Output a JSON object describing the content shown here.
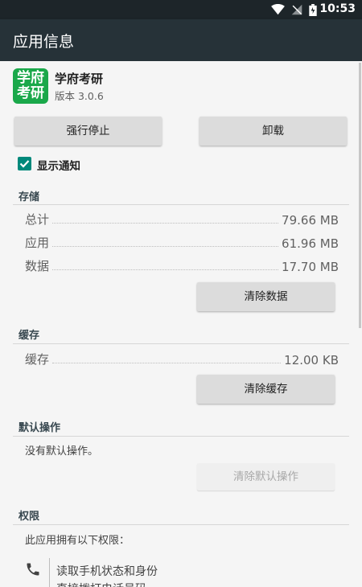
{
  "status": {
    "time": "10:53"
  },
  "appbar": {
    "title": "应用信息"
  },
  "app": {
    "icon_text_top": "学府",
    "icon_text_bottom": "考研",
    "name": "学府考研",
    "version": "版本 3.0.6"
  },
  "actions": {
    "force_stop": "强行停止",
    "uninstall": "卸载"
  },
  "notification": {
    "label": "显示通知",
    "checked": true
  },
  "storage": {
    "title": "存储",
    "rows": [
      {
        "label": "总计",
        "value": "79.66 MB"
      },
      {
        "label": "应用",
        "value": "61.96 MB"
      },
      {
        "label": "数据",
        "value": "17.70 MB"
      }
    ],
    "clear_button": "清除数据"
  },
  "cache": {
    "title": "缓存",
    "row": {
      "label": "缓存",
      "value": "12.00 KB"
    },
    "clear_button": "清除缓存"
  },
  "defaults": {
    "title": "默认操作",
    "text": "没有默认操作。",
    "clear_button": "清除默认操作"
  },
  "permissions": {
    "title": "权限",
    "intro": "此应用拥有以下权限：",
    "items": [
      "读取手机状态和身份",
      "直接拨打电话号码"
    ]
  },
  "colors": {
    "appbar": "#263238",
    "statusbar": "#1d2529",
    "accent": "#00897b",
    "app_icon": "#1aa84a"
  },
  "icons": {
    "wifi": "wifi-icon",
    "signal": "signal-off-icon",
    "battery": "battery-icon",
    "phone": "phone-icon",
    "check": "check-icon"
  }
}
